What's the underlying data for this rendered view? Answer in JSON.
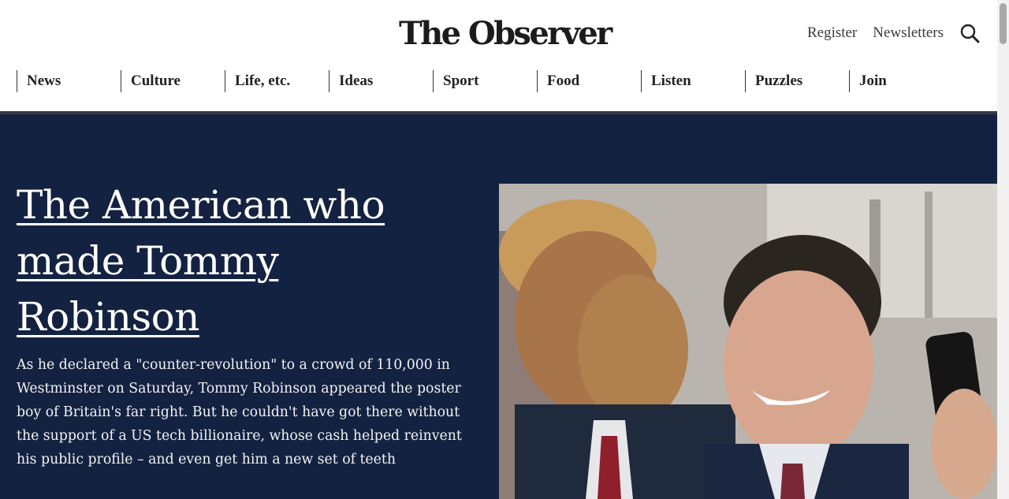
{
  "site": {
    "logo": "The Observer"
  },
  "header": {
    "links": [
      {
        "label": "Register"
      },
      {
        "label": "Newsletters"
      }
    ],
    "search_icon": "search-icon"
  },
  "nav": {
    "items": [
      {
        "label": "News"
      },
      {
        "label": "Culture"
      },
      {
        "label": "Life, etc."
      },
      {
        "label": "Ideas"
      },
      {
        "label": "Sport"
      },
      {
        "label": "Food"
      },
      {
        "label": "Listen"
      },
      {
        "label": "Puzzles"
      },
      {
        "label": "Join"
      }
    ]
  },
  "hero": {
    "headline": "The American who made Tommy Robinson",
    "standfirst": "As he declared a \"counter-revolution\" to a crowd of 110,000 in Westminster on Saturday, Tommy Robinson appeared the poster boy of Britain's far right. But he couldn't have got there without the support of a US tech billionaire, whose cash helped reinvent his public profile – and even get him a new set of teeth",
    "image_alt": "photo"
  },
  "colors": {
    "hero_background": "#132241",
    "header_rule": "#333a40",
    "text_dark": "#1c1c1c"
  }
}
